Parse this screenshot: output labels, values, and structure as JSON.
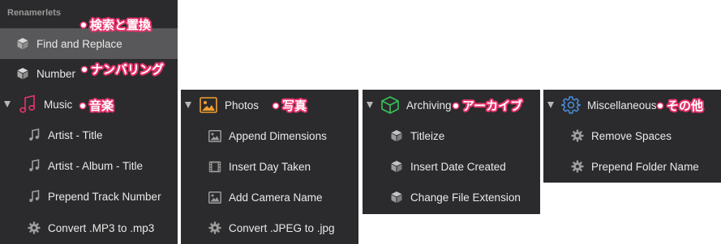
{
  "panel_main": {
    "header": "Renamerlets",
    "items": [
      {
        "label": "Find and Replace",
        "annotation": "検索と置換"
      },
      {
        "label": "Number",
        "annotation": "ナンバリング"
      },
      {
        "label": "Music",
        "annotation": "音楽"
      },
      {
        "label": "Artist - Title"
      },
      {
        "label": "Artist - Album - Title"
      },
      {
        "label": "Prepend Track Number"
      },
      {
        "label": "Convert .MP3 to .mp3"
      }
    ]
  },
  "panel_photos": {
    "group": {
      "label": "Photos",
      "annotation": "写真"
    },
    "items": [
      {
        "label": "Append Dimensions"
      },
      {
        "label": "Insert Day Taken"
      },
      {
        "label": "Add Camera Name"
      },
      {
        "label": "Convert .JPEG to .jpg"
      }
    ]
  },
  "panel_archiving": {
    "group": {
      "label": "Archiving",
      "annotation": "アーカイブ"
    },
    "items": [
      {
        "label": "Titleize"
      },
      {
        "label": "Insert Date Created"
      },
      {
        "label": "Change File Extension"
      }
    ]
  },
  "panel_misc": {
    "group": {
      "label": "Miscellaneous",
      "annotation": "その他"
    },
    "items": [
      {
        "label": "Remove Spaces"
      },
      {
        "label": "Prepend Folder Name"
      }
    ]
  },
  "colors": {
    "panel_bg": "#2b2b2d",
    "selected_bg": "#58585a",
    "annotation_outline": "#e8336d",
    "music_icon": "#e8336d",
    "photos_icon": "#f0a030",
    "archiving_icon": "#39c35a",
    "misc_icon": "#4a8fe0"
  },
  "icons": {
    "renamerlet": "cube-icon",
    "music": "music-note-icon",
    "photo": "photo-icon",
    "film": "film-icon",
    "gear": "gear-icon",
    "archive": "box-icon",
    "misc": "cog-outline-icon"
  }
}
